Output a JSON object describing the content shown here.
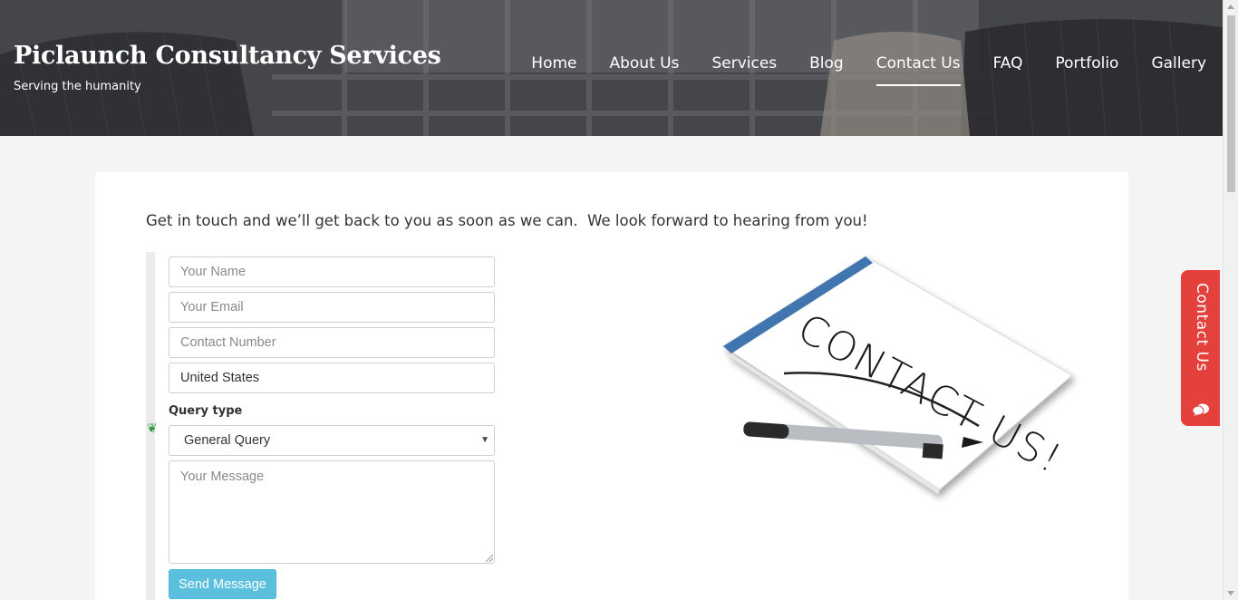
{
  "header": {
    "brand_title": "Piclaunch Consultancy Services",
    "brand_tagline": "Serving the humanity",
    "nav": [
      {
        "label": "Home",
        "active": false
      },
      {
        "label": "About Us",
        "active": false
      },
      {
        "label": "Services",
        "active": false
      },
      {
        "label": "Blog",
        "active": false
      },
      {
        "label": "Contact Us",
        "active": true
      },
      {
        "label": "FAQ",
        "active": false
      },
      {
        "label": "Portfolio",
        "active": false
      },
      {
        "label": "Gallery",
        "active": false
      }
    ]
  },
  "main": {
    "intro_text": "Get in touch and we’ll get back to you as soon as we can.  We look forward to hearing from you!",
    "form": {
      "name_placeholder": "Your Name",
      "email_placeholder": "Your Email",
      "phone_placeholder": "Contact Number",
      "country_value": "United States",
      "query_label": "Query type",
      "query_selected": "General Query",
      "message_placeholder": "Your Message",
      "submit_label": "Send Message"
    },
    "illustration": {
      "text": "CONTACT US!",
      "icon": "contact-us-notepad-illustration"
    }
  },
  "side_tab": {
    "label": "Contact Us",
    "icon": "chat-bubble-icon",
    "color": "#e4413d"
  },
  "colors": {
    "button": "#5bc0de",
    "side_tab": "#e4413d"
  }
}
